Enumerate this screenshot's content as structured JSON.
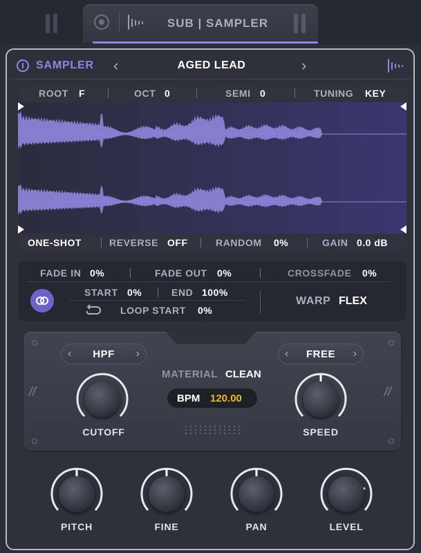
{
  "tab": {
    "title": "SUB | SAMPLER"
  },
  "header": {
    "section": "SAMPLER",
    "preset": "AGED LEAD"
  },
  "sample_info": {
    "root_label": "ROOT",
    "root_value": "F",
    "oct_label": "OCT",
    "oct_value": "0",
    "semi_label": "SEMI",
    "semi_value": "0",
    "tuning_label": "TUNING",
    "tuning_value": "KEY"
  },
  "sample_options": {
    "mode": "ONE-SHOT",
    "reverse_label": "REVERSE",
    "reverse_value": "OFF",
    "random_label": "RANDOM",
    "random_value": "0%",
    "gain_label": "GAIN",
    "gain_value": "0.0 dB"
  },
  "playback": {
    "fade_in_label": "FADE IN",
    "fade_in_value": "0%",
    "fade_out_label": "FADE OUT",
    "fade_out_value": "0%",
    "crossfade_label": "CROSSFADE",
    "crossfade_value": "0%",
    "start_label": "START",
    "start_value": "0%",
    "end_label": "END",
    "end_value": "100%",
    "loop_start_label": "LOOP START",
    "loop_start_value": "0%",
    "warp_label": "WARP",
    "warp_value": "FLEX"
  },
  "fx": {
    "filter_type": "HPF",
    "speed_mode": "FREE",
    "material_label": "MATERIAL",
    "material_value": "CLEAN",
    "bpm_label": "BPM",
    "bpm_value": "120.00",
    "cutoff_label": "CUTOFF",
    "speed_label": "SPEED"
  },
  "knobs": {
    "pitch_label": "PITCH",
    "fine_label": "FINE",
    "pan_label": "PAN",
    "level_label": "LEVEL"
  },
  "colors": {
    "accent": "#8f86ea",
    "bpm_value": "#f2b91e",
    "waveform": "#8a83d6"
  }
}
